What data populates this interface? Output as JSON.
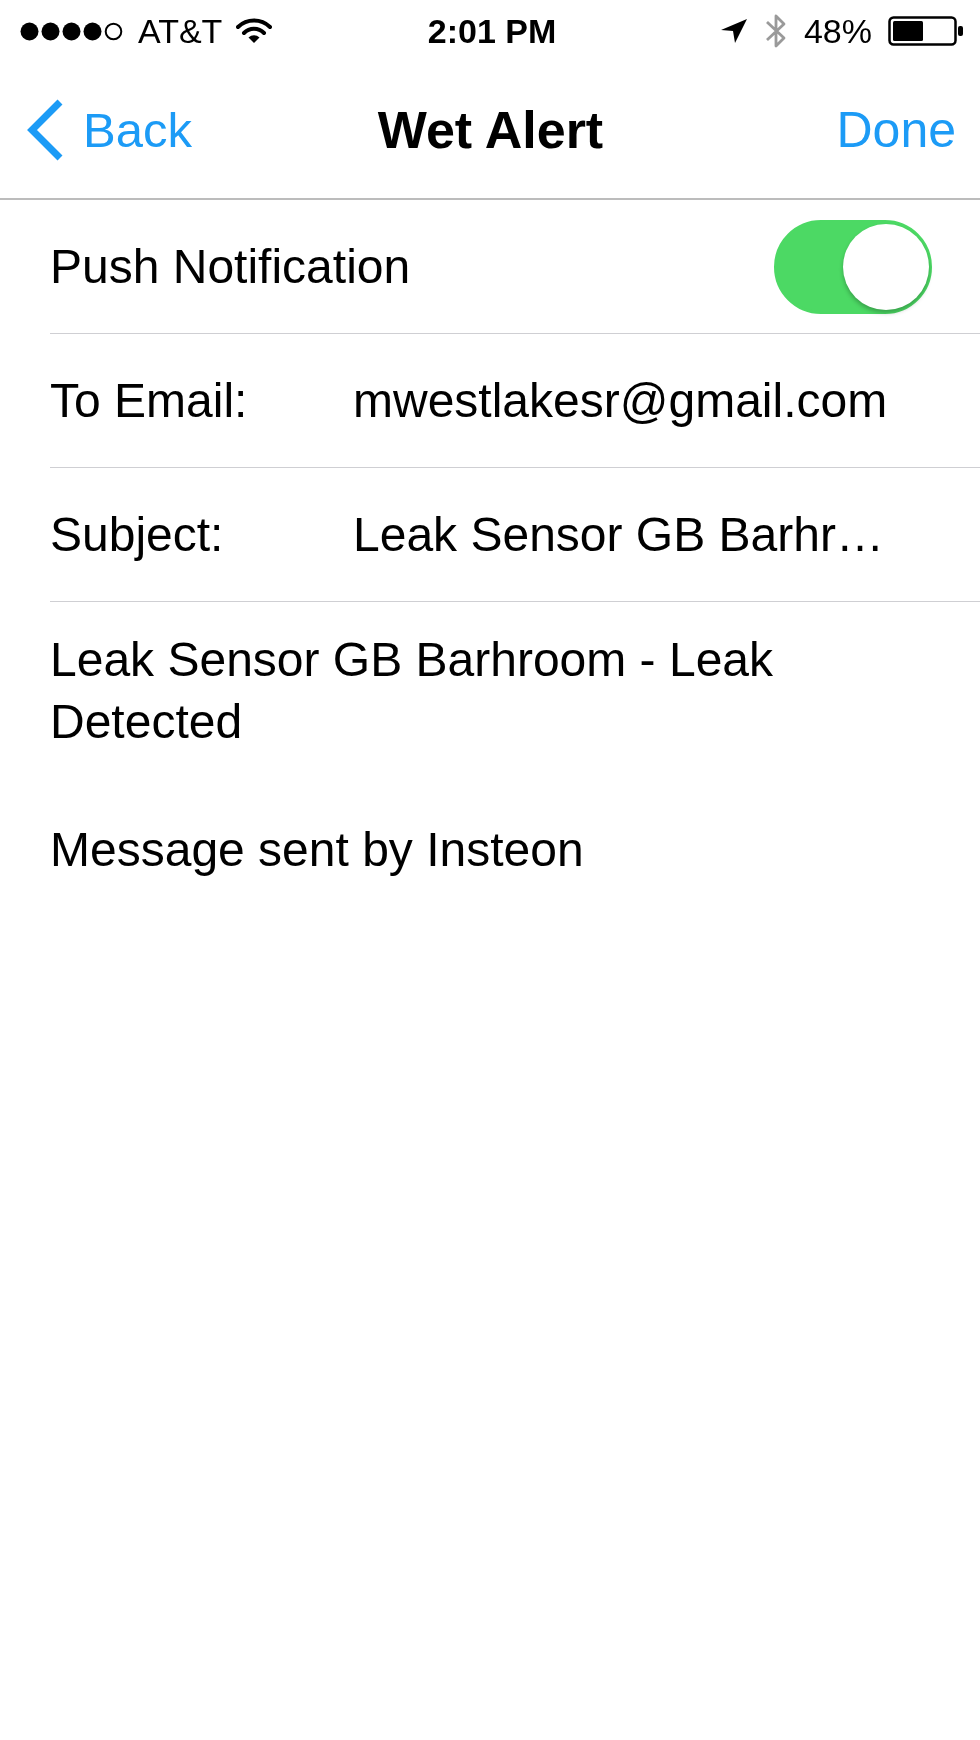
{
  "status_bar": {
    "carrier": "AT&T",
    "time": "2:01 PM",
    "battery": "48%"
  },
  "nav_bar": {
    "back": "Back",
    "title": "Wet Alert",
    "done": "Done"
  },
  "settings": [
    {
      "kind": "toggle",
      "label": "Push Notification",
      "on": true
    },
    {
      "kind": "field",
      "label": "To Email:",
      "value": "mwestlakesr@gmail.com"
    },
    {
      "kind": "field",
      "label": "Subject:",
      "value": "Leak Sensor GB Barhr…"
    }
  ],
  "message": {
    "paragraphs": [
      "Leak Sensor GB Barhroom - Leak Detected",
      "Message sent by Insteon"
    ]
  }
}
